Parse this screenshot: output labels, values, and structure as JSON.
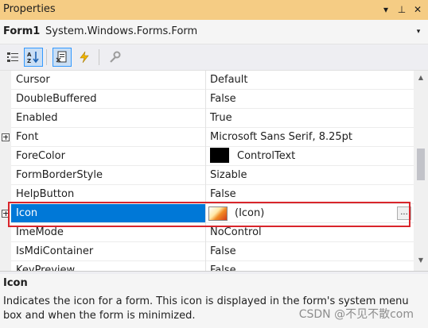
{
  "window": {
    "title": "Properties",
    "buttons": [
      {
        "name": "dropdown-icon",
        "glyph": "▾"
      },
      {
        "name": "pin-icon",
        "glyph": "⊥"
      },
      {
        "name": "close-icon",
        "glyph": "✕"
      }
    ]
  },
  "object_selector": {
    "name": "Form1",
    "type": "System.Windows.Forms.Form",
    "dropdown_glyph": "▾"
  },
  "toolbar": {
    "buttons": [
      {
        "name": "categorized-icon",
        "active": false
      },
      {
        "name": "alphabetical-icon",
        "active": true
      },
      {
        "name": "properties-icon",
        "active": true
      },
      {
        "name": "events-icon",
        "active": false
      },
      {
        "name": "property-pages-icon",
        "active": false
      }
    ]
  },
  "grid": {
    "rows": [
      {
        "name": "Cursor",
        "value": "Default",
        "expandable": false
      },
      {
        "name": "DoubleBuffered",
        "value": "False",
        "expandable": false
      },
      {
        "name": "Enabled",
        "value": "True",
        "expandable": false
      },
      {
        "name": "Font",
        "value": "Microsoft Sans Serif, 8.25pt",
        "expandable": true
      },
      {
        "name": "ForeColor",
        "value": "ControlText",
        "expandable": false,
        "color_swatch": "#000000"
      },
      {
        "name": "FormBorderStyle",
        "value": "Sizable",
        "expandable": false
      },
      {
        "name": "HelpButton",
        "value": "False",
        "expandable": false
      },
      {
        "name": "Icon",
        "value": "(Icon)",
        "expandable": true,
        "selected": true,
        "ellipsis": "..."
      },
      {
        "name": "ImeMode",
        "value": "NoControl",
        "expandable": false
      },
      {
        "name": "IsMdiContainer",
        "value": "False",
        "expandable": false
      },
      {
        "name": "KeyPreview",
        "value": "False",
        "expandable": false
      }
    ]
  },
  "scrollbar": {
    "up_glyph": "▲",
    "down_glyph": "▼"
  },
  "description": {
    "title": "Icon",
    "text": "Indicates the icon for a form. This icon is displayed in the form's system menu box and when the form is minimized."
  },
  "watermark": "CSDN @不见不散com",
  "colors": {
    "titlebar": "#f5cc84",
    "selection": "#0078d7",
    "highlight_border": "#d9252b"
  }
}
